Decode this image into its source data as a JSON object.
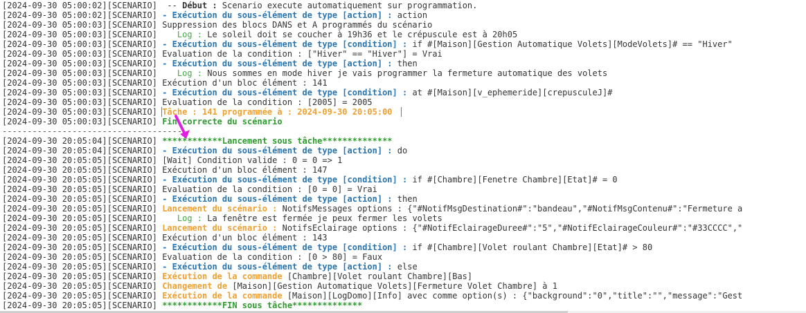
{
  "log_lines": [
    {
      "ts": "[2024-09-30 05:00:02][SCENARIO]",
      "type": "debut",
      "label": "Début :",
      "prefix": " -- ",
      "text": " Scenario execute automatiquement sur programmation."
    },
    {
      "ts": "[2024-09-30 05:00:02][SCENARIO]",
      "type": "sub",
      "label": "- Exécution du sous-élément de type [action] :",
      "text": " action"
    },
    {
      "ts": "[2024-09-30 05:00:03][SCENARIO]",
      "type": "plain",
      "text": "Suppression des blocs DANS et A programmés du scénario"
    },
    {
      "ts": "[2024-09-30 05:00:03][SCENARIO]",
      "type": "log",
      "label": "Log :",
      "text": " Le soleil doit se coucher à 19h36 et le crépuscule est à 20h05"
    },
    {
      "ts": "[2024-09-30 05:00:03][SCENARIO]",
      "type": "sub",
      "label": "- Exécution du sous-élément de type [condition] :",
      "text": " if #[Maison][Gestion Automatique Volets][ModeVolets]# == \"Hiver\""
    },
    {
      "ts": "[2024-09-30 05:00:03][SCENARIO]",
      "type": "plain",
      "text": "Evaluation de la condition : [\"Hiver\" == \"Hiver\"] = Vrai"
    },
    {
      "ts": "[2024-09-30 05:00:03][SCENARIO]",
      "type": "sub",
      "label": "- Exécution du sous-élément de type [action] :",
      "text": " then"
    },
    {
      "ts": "[2024-09-30 05:00:03][SCENARIO]",
      "type": "log",
      "label": "Log :",
      "text": " Nous sommes en mode hiver je vais programmer la fermeture automatique des volets"
    },
    {
      "ts": "[2024-09-30 05:00:03][SCENARIO]",
      "type": "plain",
      "text": "Exécution d'un bloc élément : 141"
    },
    {
      "ts": "[2024-09-30 05:00:03][SCENARIO]",
      "type": "sub",
      "label": "- Exécution du sous-élément de type [condition] :",
      "text": " at #[Maison][v_ephemeride][crepusculeJ]#"
    },
    {
      "ts": "[2024-09-30 05:00:03][SCENARIO]",
      "type": "plain",
      "text": "Evaluation de la condition : [2005] = 2005"
    },
    {
      "ts": "[2024-09-30 05:00:03][SCENARIO]",
      "type": "task",
      "label": "Tâche : 141 programmée à : 2024-09-30 20:05:00"
    },
    {
      "ts": "[2024-09-30 05:00:03][SCENARIO]",
      "type": "green",
      "label": "Fin correcte du scénario"
    },
    {
      "type": "separator",
      "text": "------------------------------------"
    },
    {
      "ts": "[2024-09-30 20:05:04][SCENARIO]",
      "type": "green",
      "label": "************Lancement sous tâche**************"
    },
    {
      "ts": "[2024-09-30 20:05:04][SCENARIO]",
      "type": "sub",
      "label": "- Exécution du sous-élément de type [action] :",
      "text": " do"
    },
    {
      "ts": "[2024-09-30 20:05:05][SCENARIO]",
      "type": "plain",
      "text": "[Wait] Condition valide : 0 = 0 => 1"
    },
    {
      "ts": "[2024-09-30 20:05:05][SCENARIO]",
      "type": "plain",
      "text": "Exécution d'un bloc élément : 147"
    },
    {
      "ts": "[2024-09-30 20:05:05][SCENARIO]",
      "type": "sub",
      "label": "- Exécution du sous-élément de type [condition] :",
      "text": " if #[Chambre][Fenetre Chambre][Etat]# = 0"
    },
    {
      "ts": "[2024-09-30 20:05:05][SCENARIO]",
      "type": "plain",
      "text": "Evaluation de la condition : [0 = 0] = Vrai"
    },
    {
      "ts": "[2024-09-30 20:05:05][SCENARIO]",
      "type": "sub",
      "label": "- Exécution du sous-élément de type [action] :",
      "text": " then"
    },
    {
      "ts": "[2024-09-30 20:05:05][SCENARIO]",
      "type": "launch",
      "label": "Lancement du scénario :",
      "text": " NotifsMessages options : {\"#NotifMsgDestination#\":\"bandeau\",\"#NotifMsgContenu#\":\"Fermeture a"
    },
    {
      "ts": "[2024-09-30 20:05:05][SCENARIO]",
      "type": "log",
      "label": "Log :",
      "text": " La fenêtre est fermée je peux fermer les volets"
    },
    {
      "ts": "[2024-09-30 20:05:05][SCENARIO]",
      "type": "launch",
      "label": "Lancement du scénario :",
      "text": " NotifsEclairage options : {\"#NotifEclairageDuree#\":\"5\",\"#NotifEclairageCouleur#\":\"#33CCCC\",\""
    },
    {
      "ts": "[2024-09-30 20:05:05][SCENARIO]",
      "type": "plain",
      "text": "Exécution d'un bloc élément : 143"
    },
    {
      "ts": "[2024-09-30 20:05:05][SCENARIO]",
      "type": "sub",
      "label": "- Exécution du sous-élément de type [condition] :",
      "text": " if #[Chambre][Volet roulant Chambre][Etat]# > 80"
    },
    {
      "ts": "[2024-09-30 20:05:05][SCENARIO]",
      "type": "plain",
      "text": "Evaluation de la condition : [0 > 80] = Faux"
    },
    {
      "ts": "[2024-09-30 20:05:05][SCENARIO]",
      "type": "sub",
      "label": "- Exécution du sous-élément de type [action] :",
      "text": " else"
    },
    {
      "ts": "[2024-09-30 20:05:05][SCENARIO]",
      "type": "launch",
      "label": "Exécution de la commande",
      "text": " [Chambre][Volet roulant Chambre][Bas]"
    },
    {
      "ts": "[2024-09-30 20:05:05][SCENARIO]",
      "type": "launch",
      "label": "Changement de",
      "text": " [Maison][Gestion Automatique Volets][Fermeture Volet Chambre] à 1"
    },
    {
      "ts": "[2024-09-30 20:05:05][SCENARIO]",
      "type": "launch",
      "label": "Exécution de la commande",
      "text": " [Maison][LogDomo][Info] avec comme option(s) : {\"background\":\"0\",\"title\":\"\",\"message\":\"Gest"
    },
    {
      "ts": "[2024-09-30 20:05:05][SCENARIO]",
      "type": "green",
      "label": "************FIN sous tâche**************"
    }
  ],
  "colors": {
    "text": "#333333",
    "subelement": "#2a74b0",
    "log": "#45a845",
    "orange": "#f0a030",
    "green": "#2e9b2e",
    "highlight_box": "#e030c8",
    "arrow": "#e020e0"
  },
  "icons": {
    "annotation_arrow": "arrow-icon"
  }
}
